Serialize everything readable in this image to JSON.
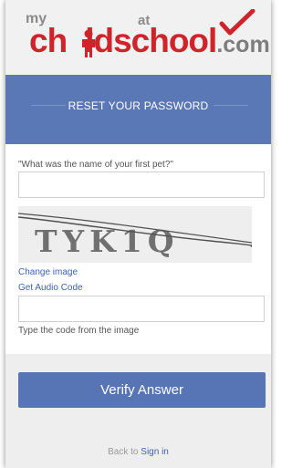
{
  "logo": {
    "my": "my",
    "word_left": "ch",
    "word_middle": "ld",
    "at": "at",
    "school": "school",
    "dotcom": ".com",
    "brand_red": "#d0242b",
    "brand_grey": "#7d7d7d"
  },
  "header": {
    "title": "RESET YOUR PASSWORD",
    "color": "#5a78b6"
  },
  "form": {
    "security_question": "\"What was the name of your first pet?\"",
    "answer_value": "",
    "captcha_text": "TYK1Q",
    "change_image_label": "Change image",
    "audio_code_label": "Get Audio Code",
    "code_value": "",
    "code_hint": "Type the code from the image"
  },
  "footer": {
    "verify_label": "Verify Answer",
    "back_prefix": "Back to",
    "sign_in_label": "Sign in"
  }
}
